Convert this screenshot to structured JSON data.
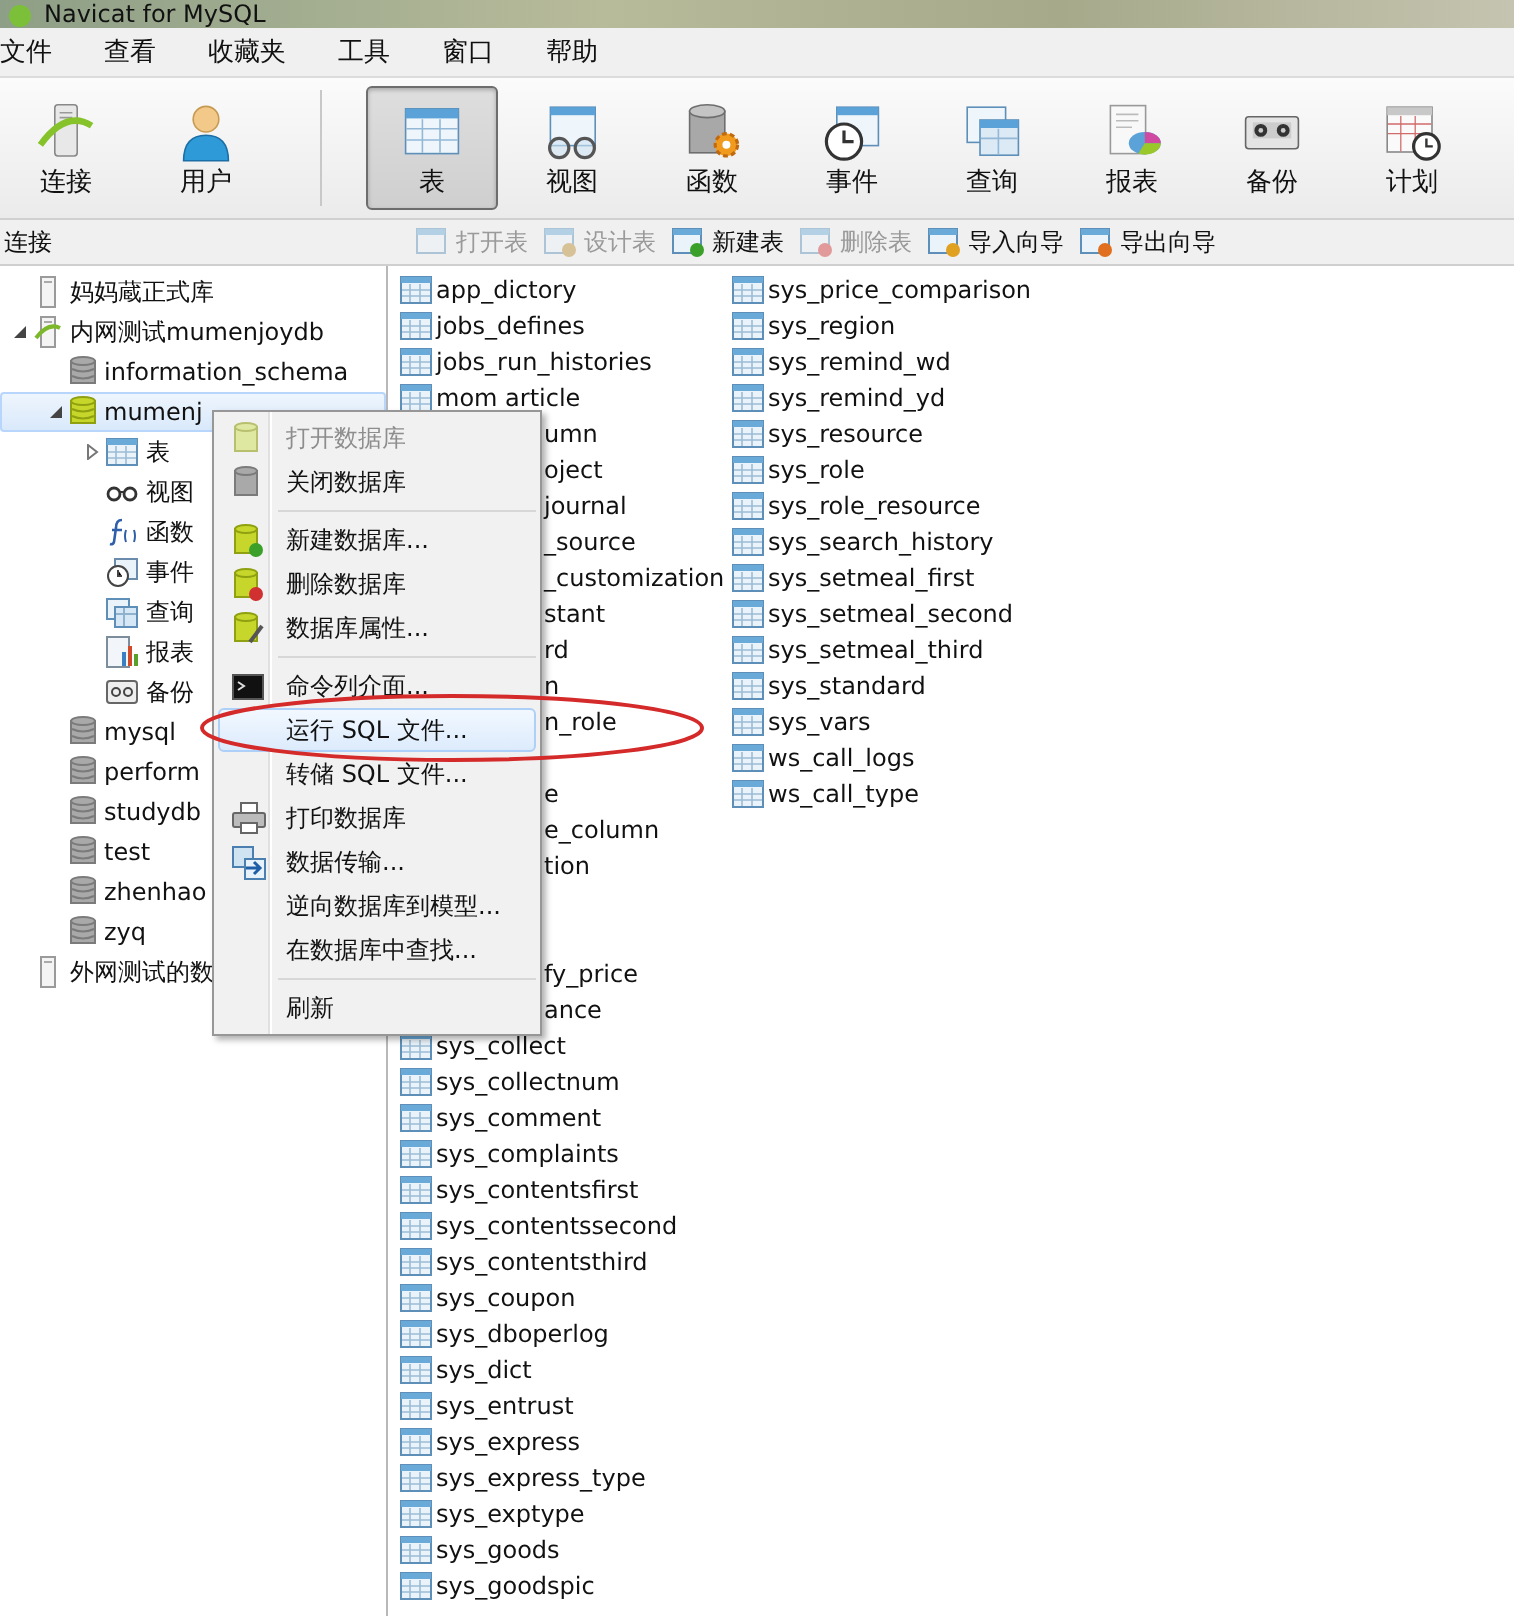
{
  "window": {
    "title": "Navicat for MySQL"
  },
  "menu_bar": [
    "文件",
    "查看",
    "收藏夹",
    "工具",
    "窗口",
    "帮助"
  ],
  "toolbar": {
    "connection_group": [
      {
        "label": "连接",
        "kind": "connection",
        "selected": false
      },
      {
        "label": "用户",
        "kind": "user",
        "selected": false
      }
    ],
    "object_group": [
      {
        "label": "表",
        "kind": "table",
        "selected": true
      },
      {
        "label": "视图",
        "kind": "view",
        "selected": false
      },
      {
        "label": "函数",
        "kind": "function",
        "selected": false
      },
      {
        "label": "事件",
        "kind": "event",
        "selected": false
      },
      {
        "label": "查询",
        "kind": "query",
        "selected": false
      },
      {
        "label": "报表",
        "kind": "report",
        "selected": false
      },
      {
        "label": "备份",
        "kind": "backup",
        "selected": false
      },
      {
        "label": "计划",
        "kind": "schedule",
        "selected": false
      }
    ]
  },
  "object_toolbar": {
    "section_label": "连接",
    "actions": [
      {
        "label": "打开表",
        "kind": "open",
        "disabled": true
      },
      {
        "label": "设计表",
        "kind": "design",
        "disabled": true
      },
      {
        "label": "新建表",
        "kind": "new",
        "disabled": false
      },
      {
        "label": "删除表",
        "kind": "delete",
        "disabled": true
      },
      {
        "label": "导入向导",
        "kind": "import",
        "disabled": false
      },
      {
        "label": "导出向导",
        "kind": "export",
        "disabled": false
      }
    ]
  },
  "tree": [
    {
      "label": "妈妈蔵正式库",
      "kind": "connection",
      "open": false,
      "selected": false
    },
    {
      "label": "内网测试mumenjoydb",
      "kind": "connection",
      "open": true,
      "expanded": true,
      "selected": false,
      "children": [
        {
          "label": "information_schema",
          "kind": "database",
          "open": false,
          "selected": false
        },
        {
          "label": "mumenj",
          "kind": "database",
          "open": true,
          "expanded": true,
          "selected": true,
          "children": [
            {
              "label": "表",
              "kind": "tables",
              "expanded": false,
              "selected": false
            },
            {
              "label": "视图",
              "kind": "views",
              "selected": false
            },
            {
              "label": "函数",
              "kind": "functions",
              "selected": false
            },
            {
              "label": "事件",
              "kind": "events",
              "selected": false
            },
            {
              "label": "查询",
              "kind": "queries",
              "selected": false
            },
            {
              "label": "报表",
              "kind": "reports",
              "selected": false
            },
            {
              "label": "备份",
              "kind": "backups",
              "selected": false
            }
          ]
        },
        {
          "label": "mysql",
          "kind": "database",
          "open": false,
          "selected": false
        },
        {
          "label": "perform",
          "kind": "database",
          "open": false,
          "selected": false
        },
        {
          "label": "studydb",
          "kind": "database",
          "open": false,
          "selected": false
        },
        {
          "label": "test",
          "kind": "database",
          "open": false,
          "selected": false
        },
        {
          "label": "zhenhao",
          "kind": "database",
          "open": false,
          "selected": false
        },
        {
          "label": "zyq",
          "kind": "database",
          "open": false,
          "selected": false
        }
      ]
    },
    {
      "label": "外网测试的数",
      "kind": "connection",
      "open": false,
      "selected": false
    }
  ],
  "context_menu": [
    {
      "label": "打开数据库",
      "kind": "open-db",
      "disabled": true,
      "highlighted": false
    },
    {
      "label": "关闭数据库",
      "kind": "close-db",
      "disabled": false,
      "highlighted": false
    },
    {
      "kind": "separator"
    },
    {
      "label": "新建数据库...",
      "kind": "new-db",
      "disabled": false,
      "highlighted": false
    },
    {
      "label": "删除数据库",
      "kind": "delete-db",
      "disabled": false,
      "highlighted": false
    },
    {
      "label": "数据库属性...",
      "kind": "db-properties",
      "disabled": false,
      "highlighted": false
    },
    {
      "kind": "separator"
    },
    {
      "label": "命令列介面...",
      "kind": "console",
      "disabled": false,
      "highlighted": false
    },
    {
      "label": "运行 SQL 文件...",
      "kind": "plain",
      "disabled": false,
      "highlighted": true
    },
    {
      "label": "转储 SQL 文件...",
      "kind": "plain",
      "disabled": false,
      "highlighted": false
    },
    {
      "label": "打印数据库",
      "kind": "print",
      "disabled": false,
      "highlighted": false
    },
    {
      "label": "数据传输...",
      "kind": "transfer",
      "disabled": false,
      "highlighted": false
    },
    {
      "label": "逆向数据库到模型...",
      "kind": "plain",
      "disabled": false,
      "highlighted": false
    },
    {
      "label": "在数据库中查找...",
      "kind": "plain",
      "disabled": false,
      "highlighted": false
    },
    {
      "kind": "separator"
    },
    {
      "label": "刷新",
      "kind": "plain",
      "disabled": false,
      "highlighted": false
    }
  ],
  "tables": [
    [
      {
        "name": "app_dictory",
        "kind": "table"
      },
      {
        "name": "jobs_defines",
        "kind": "table"
      },
      {
        "name": "jobs_run_histories",
        "kind": "table"
      },
      {
        "name": "mom article",
        "kind": "table"
      },
      {
        "name": "umn",
        "kind": "partial"
      },
      {
        "name": "oject",
        "kind": "partial"
      },
      {
        "name": "journal",
        "kind": "partial"
      },
      {
        "name": "_source",
        "kind": "partial"
      },
      {
        "name": "_customization",
        "kind": "partial"
      },
      {
        "name": "stant",
        "kind": "partial"
      },
      {
        "name": "rd",
        "kind": "partial"
      },
      {
        "name": "n",
        "kind": "partial"
      },
      {
        "name": "n_role",
        "kind": "partial"
      },
      {
        "kind": "hidden"
      },
      {
        "name": "e",
        "kind": "partial"
      },
      {
        "name": "e_column",
        "kind": "partial"
      },
      {
        "name": "tion",
        "kind": "partial"
      },
      {
        "kind": "hidden"
      },
      {
        "kind": "hidden"
      },
      {
        "name": "fy_price",
        "kind": "partial"
      },
      {
        "name": "ance",
        "kind": "partial"
      },
      {
        "name": "sys_collect",
        "kind": "table"
      },
      {
        "name": "sys_collectnum",
        "kind": "table"
      },
      {
        "name": "sys_comment",
        "kind": "table"
      },
      {
        "name": "sys_complaints",
        "kind": "table"
      },
      {
        "name": "sys_contentsfirst",
        "kind": "table"
      },
      {
        "name": "sys_contentssecond",
        "kind": "table"
      },
      {
        "name": "sys_contentsthird",
        "kind": "table"
      },
      {
        "name": "sys_coupon",
        "kind": "table"
      },
      {
        "name": "sys_dboperlog",
        "kind": "table"
      },
      {
        "name": "sys_dict",
        "kind": "table"
      },
      {
        "name": "sys_entrust",
        "kind": "table"
      },
      {
        "name": "sys_express",
        "kind": "table"
      },
      {
        "name": "sys_express_type",
        "kind": "table"
      },
      {
        "name": "sys_exptype",
        "kind": "table"
      },
      {
        "name": "sys_goods",
        "kind": "table"
      },
      {
        "name": "sys_goodspic",
        "kind": "table"
      }
    ],
    [
      {
        "name": "sys_price_comparison",
        "kind": "table"
      },
      {
        "name": "sys_region",
        "kind": "table"
      },
      {
        "name": "sys_remind_wd",
        "kind": "table"
      },
      {
        "name": "sys_remind_yd",
        "kind": "table"
      },
      {
        "name": "sys_resource",
        "kind": "table"
      },
      {
        "name": "sys_role",
        "kind": "table"
      },
      {
        "name": "sys_role_resource",
        "kind": "table"
      },
      {
        "name": "sys_search_history",
        "kind": "table"
      },
      {
        "name": "sys_setmeal_first",
        "kind": "table"
      },
      {
        "name": "sys_setmeal_second",
        "kind": "table"
      },
      {
        "name": "sys_setmeal_third",
        "kind": "table"
      },
      {
        "name": "sys_standard",
        "kind": "table"
      },
      {
        "name": "sys_vars",
        "kind": "table"
      },
      {
        "name": "ws_call_logs",
        "kind": "table"
      },
      {
        "name": "ws_call_type",
        "kind": "table"
      }
    ]
  ]
}
